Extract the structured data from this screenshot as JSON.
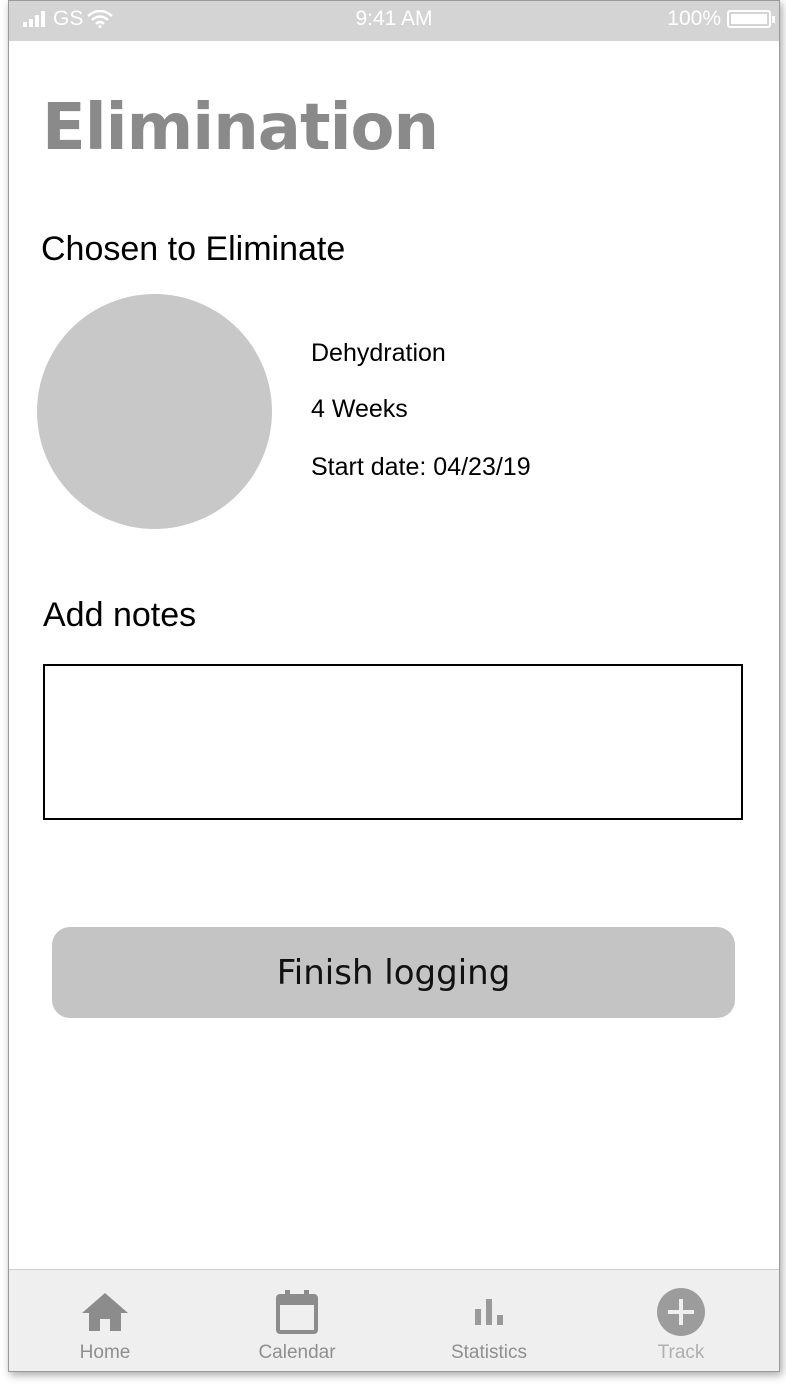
{
  "status_bar": {
    "carrier": "GS",
    "time": "9:41 AM",
    "battery": "100%"
  },
  "page": {
    "title": "Elimination"
  },
  "chosen": {
    "heading": "Chosen to Eliminate",
    "item_name": "Dehydration",
    "duration": "4 Weeks",
    "start_date": "Start date: 04/23/19"
  },
  "notes": {
    "heading": "Add notes",
    "value": "",
    "placeholder": ""
  },
  "finish_button": {
    "label": "Finish logging"
  },
  "tabbar": {
    "items": [
      {
        "label": "Home",
        "icon": "home-icon"
      },
      {
        "label": "Calendar",
        "icon": "calendar-icon"
      },
      {
        "label": "Statistics",
        "icon": "statistics-icon"
      },
      {
        "label": "Track",
        "icon": "plus-circle-icon"
      }
    ]
  },
  "colors": {
    "status_bar_bg": "#d4d4d4",
    "title": "#8a8a8a",
    "avatar": "#c8c8c8",
    "button_bg": "#c4c4c4",
    "tabbar_bg": "#efefef"
  }
}
